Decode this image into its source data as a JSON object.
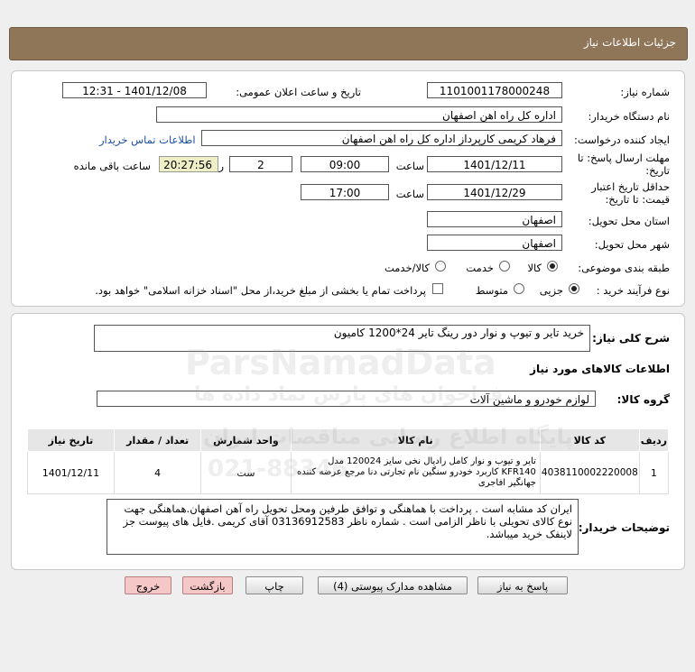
{
  "header": {
    "title": "جزئیات اطلاعات نیاز"
  },
  "form": {
    "need_number_label": "شماره نیاز:",
    "need_number": "1101001178000248",
    "announce_label": "تاریخ و ساعت اعلان عمومی:",
    "announce_value": "1401/12/08 - 12:31",
    "buyer_org_label": "نام دستگاه خریدار:",
    "buyer_org": "اداره کل راه اهن اصفهان",
    "creator_label": "ایجاد کننده درخواست:",
    "creator": "فرهاد کریمی کارپرداز اداره کل راه اهن اصفهان",
    "contact_link": "اطلاعات تماس خریدار",
    "deadline_label_1": "مهلت ارسال پاسخ: تا",
    "deadline_label_2": "تاریخ:",
    "deadline_date": "1401/12/11",
    "time_label": "ساعت",
    "deadline_time": "09:00",
    "days_value": "2",
    "days_label": "روز و",
    "remaining_time": "20:27:56",
    "remaining_label": "ساعت باقی مانده",
    "validity_label_1": "حداقل تاریخ اعتبار",
    "validity_label_2": "قیمت: تا تاریخ:",
    "validity_date": "1401/12/29",
    "validity_time_label": "ساعت",
    "validity_time": "17:00",
    "province_label": "استان محل تحویل:",
    "province": "اصفهان",
    "city_label": "شهر محل تحویل:",
    "city": "اصفهان",
    "category_label": "طبقه بندی موضوعی:",
    "category_options": [
      "کالا",
      "خدمت",
      "کالا/خدمت"
    ],
    "category_selected": "کالا",
    "process_label": "نوع فرآیند خرید :",
    "process_options": [
      "جزیی",
      "متوسط"
    ],
    "process_selected": "جزیی",
    "payment_note": "پرداخت تمام یا بخشی از مبلغ خرید،از محل \"اسناد خزانه اسلامی\" خواهد بود."
  },
  "summary": {
    "label": "شرح کلی نیاز:",
    "value": "خرید تایر و تیوپ و نوار دور رینگ تایر 24*1200 کامیون"
  },
  "goods_section": {
    "title": "اطلاعات کالاهای مورد نیاز",
    "group_label": "گروه کالا:",
    "group_value": "لوازم خودرو و ماشین آلات"
  },
  "table": {
    "headers": [
      "ردیف",
      "کد کالا",
      "نام کالا",
      "واحد شمارش",
      "تعداد / مقدار",
      "تاریخ نیاز"
    ],
    "rows": [
      {
        "row": "1",
        "code": "4038110002220008",
        "name": "تایر و تیوب و نوار کامل رادیال نخی سایز 120024 مدل KFR140 کاربرد خودرو سنگین نام تجارتی دنا مرجع عرضه کننده جهانگیر افاجری",
        "unit": "ست",
        "qty": "4",
        "date": "1401/12/11"
      }
    ]
  },
  "buyer_notes": {
    "label": "توضیحات خریدار:",
    "text": "ایران کد مشابه است . پرداخت با هماهنگی و توافق طرفین ومحل تحویل راه آهن اصفهان.هماهنگی جهت نوع کالای تحویلی با ناظر الزامی است . شماره ناظر 03136912583 آقای کریمی .فایل های پیوست جز لاینفک خرید میباشد."
  },
  "buttons": {
    "reply": "پاسخ به نیاز",
    "attachments": "مشاهده مدارک پیوستی (4)",
    "print": "چاپ",
    "back": "بازگشت",
    "exit": "خروج"
  },
  "watermark": {
    "brand": "ParsNamadData",
    "line1": "پایگاه اطلاع رسانی مناقصات ایران",
    "line2": "فراخوان های پارس نماد داده ها",
    "phone": "021-88346..."
  }
}
